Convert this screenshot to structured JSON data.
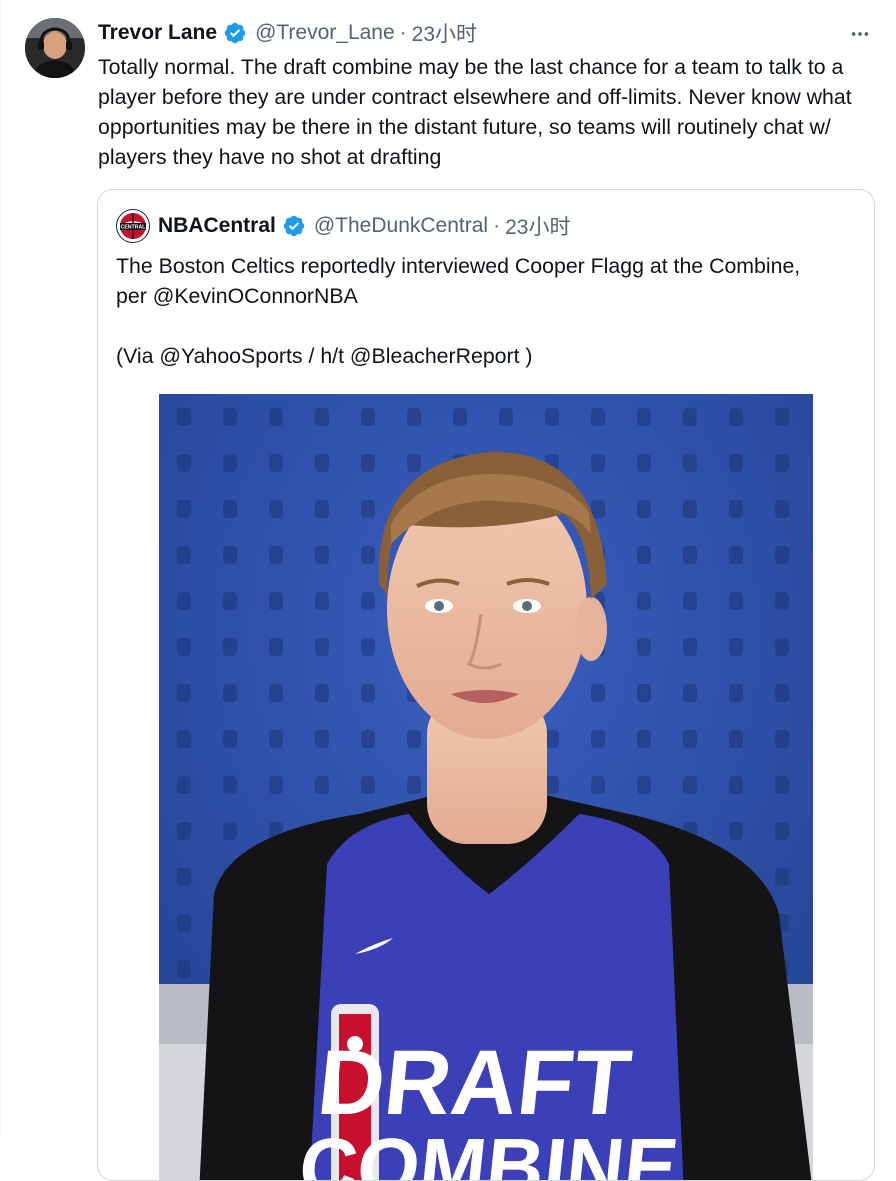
{
  "tweet": {
    "author_name": "Trevor Lane",
    "handle": "@Trevor_Lane",
    "separator": "·",
    "time": "23小时",
    "text": "Totally normal. The draft combine may be the last chance for a team to talk to a player before they are under contract elsewhere and off-limits. Never know what opportunities may be there in the distant future, so teams will routinely chat w/ players they have no shot at drafting"
  },
  "quoted": {
    "author_name": "NBACentral",
    "handle": "@TheDunkCentral",
    "separator": "·",
    "time": "23小时",
    "line1": "The Boston Celtics reportedly interviewed Cooper Flagg at the Combine, per @KevinOConnorNBA",
    "line2": "(Via @YahooSports / h/t @BleacherReport )",
    "avatar_text": "CENTRAL",
    "jersey_text": "DRAFT",
    "jersey_text2": "COMBINE"
  },
  "colors": {
    "verified": "#1d9bf0",
    "secondary_text": "#536471",
    "photo_background": "#2d4fa8",
    "jersey": "#3b3fb8"
  },
  "icons": {
    "verified": "verified-badge-icon",
    "more": "more-horizontal-icon"
  }
}
